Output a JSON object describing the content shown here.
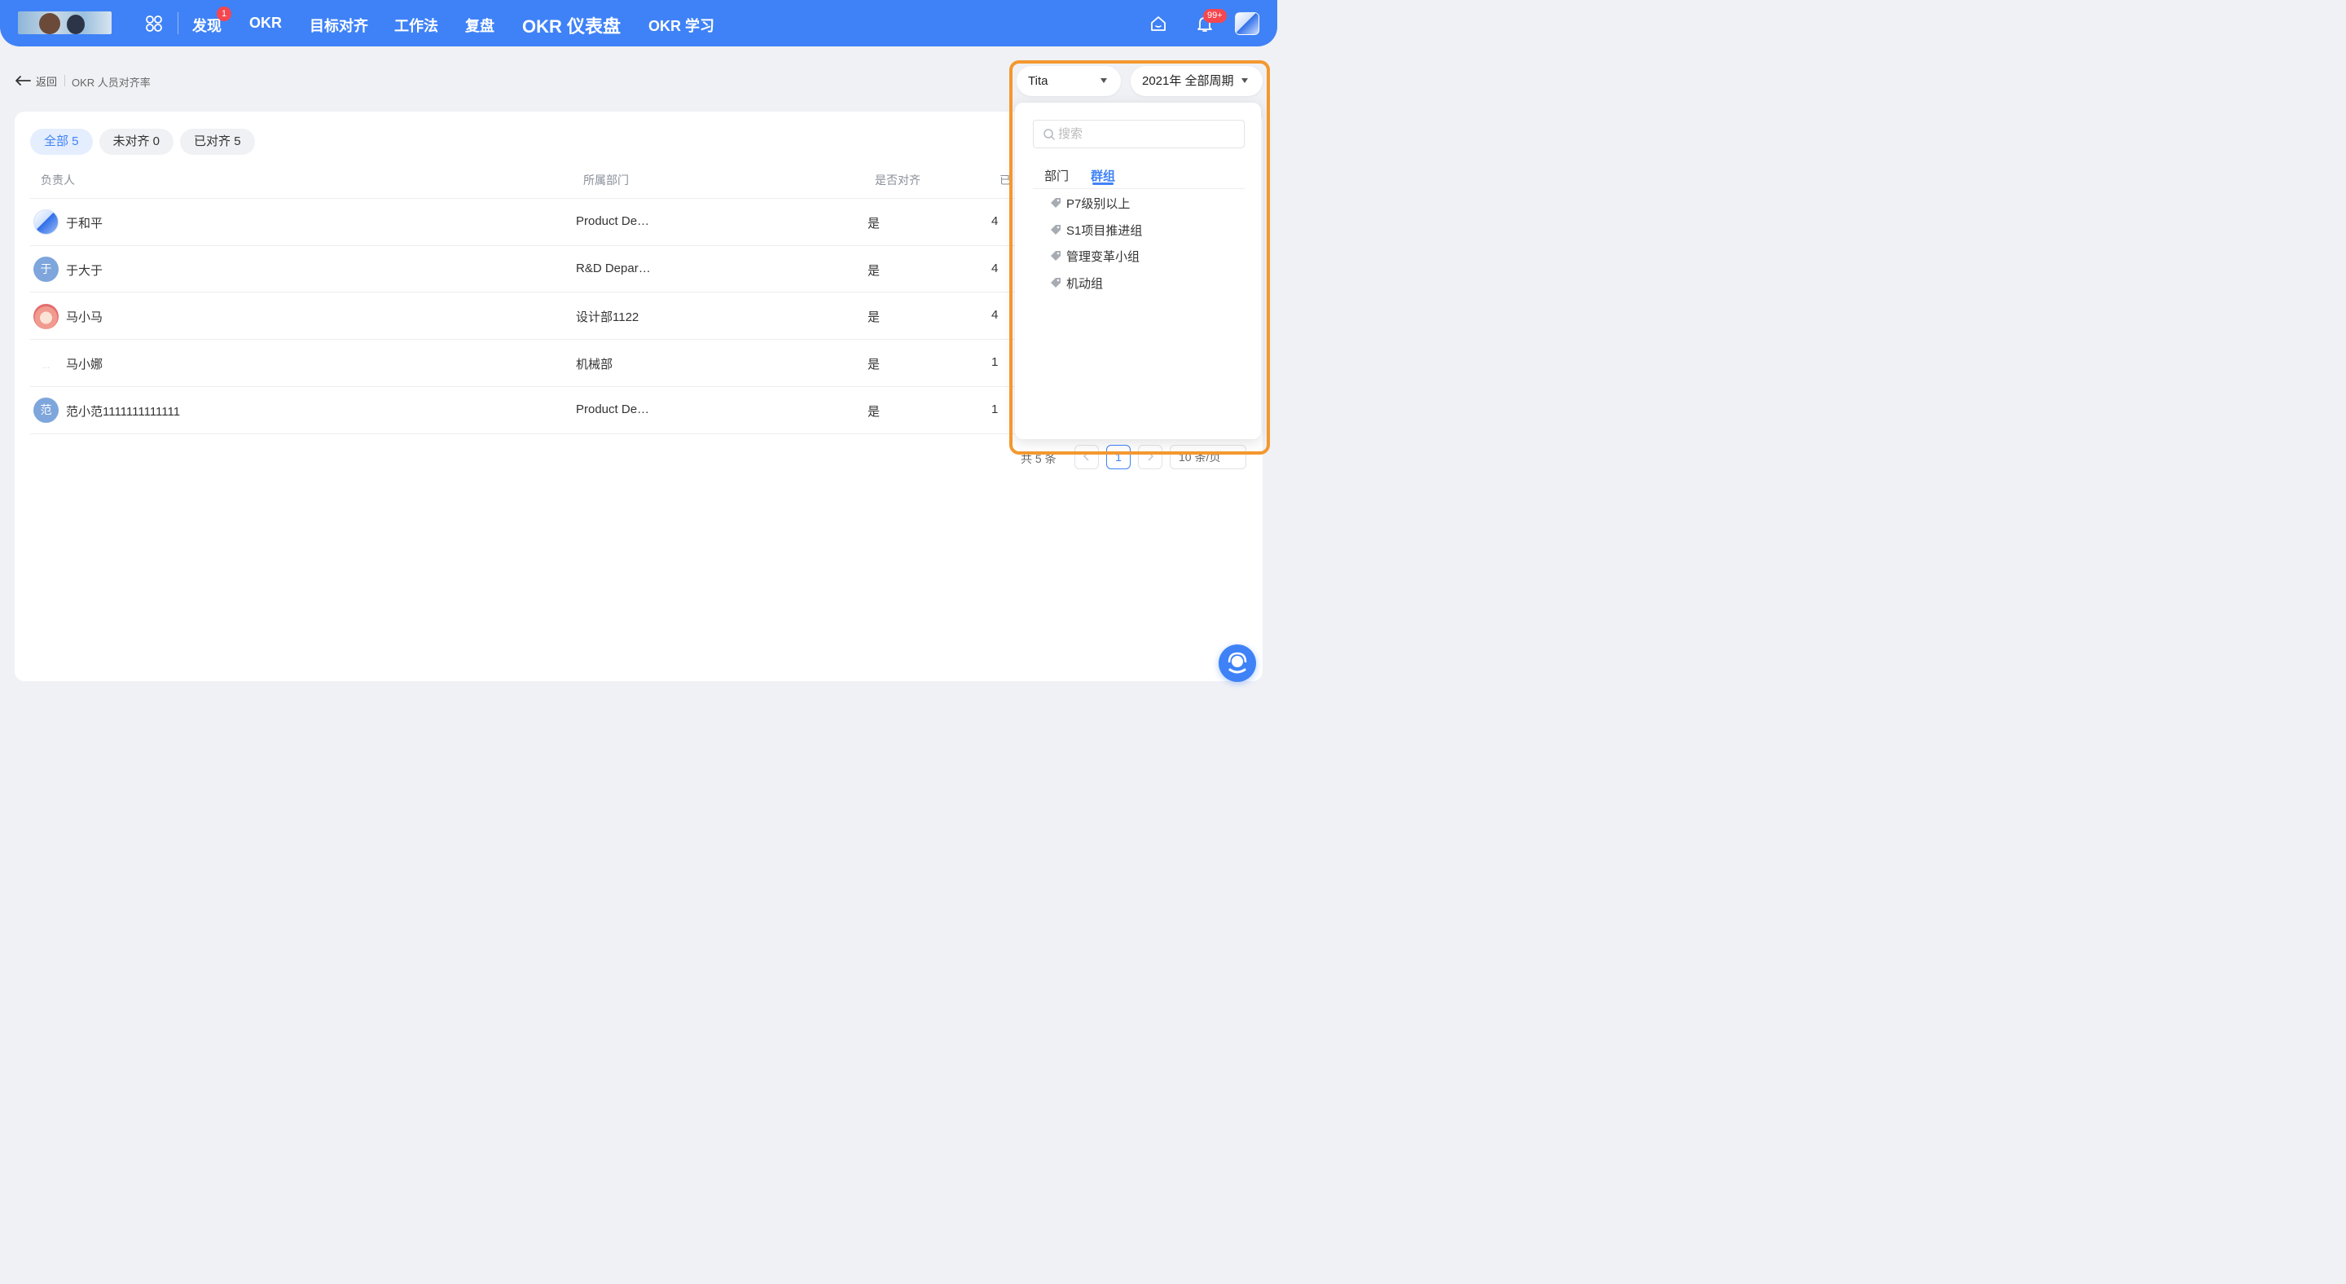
{
  "topnav": {
    "badge_discover": "1",
    "items": [
      "发现",
      "OKR",
      "目标对齐",
      "工作法",
      "复盘",
      "OKR 仪表盘",
      "OKR 学习"
    ],
    "bell_badge": "99+",
    "accent": "#3f82f7"
  },
  "breadcrumb": {
    "back": "返回",
    "page": "OKR 人员对齐率"
  },
  "filters": [
    {
      "label": "全部 5",
      "active": true
    },
    {
      "label": "未对齐 0",
      "active": false
    },
    {
      "label": "已对齐 5",
      "active": false
    }
  ],
  "table": {
    "headers": [
      "负责人",
      "所属部门",
      "是否对齐",
      "已"
    ],
    "rows": [
      {
        "avatar": "",
        "name": "于和平",
        "dept": "Product De…",
        "aligned": "是",
        "count": "4"
      },
      {
        "avatar": "于",
        "name": "于大于",
        "dept": "R&D Depar…",
        "aligned": "是",
        "count": "4"
      },
      {
        "avatar": "",
        "name": "马小马",
        "dept": "设计部1122",
        "aligned": "是",
        "count": "4"
      },
      {
        "avatar": "",
        "name": "马小娜",
        "dept": "机械部",
        "aligned": "是",
        "count": "1"
      },
      {
        "avatar": "范",
        "name": "范小范1111111111111",
        "dept": "Product De…",
        "aligned": "是",
        "count": "1"
      }
    ]
  },
  "pagination": {
    "total": "共 5 条",
    "current": "1",
    "page_size": "10 条/页"
  },
  "selectors": {
    "org": "Tita",
    "period": "2021年 全部周期"
  },
  "dropdown": {
    "search_placeholder": "搜索",
    "tabs": [
      "部门",
      "群组"
    ],
    "active_tab": "群组",
    "items": [
      "P7级别以上",
      "S1项目推进组",
      "管理变革小组",
      "机动组"
    ]
  },
  "icons": [
    "apps-icon",
    "home-icon",
    "bell-icon",
    "back-arrow-icon",
    "search-icon",
    "tag-icon",
    "caret-down-icon",
    "chevron-left-icon",
    "chevron-right-icon",
    "headset-icon"
  ],
  "colors": {
    "highlight": "#f3982f",
    "avatar_blue": "#7ea6dc"
  }
}
